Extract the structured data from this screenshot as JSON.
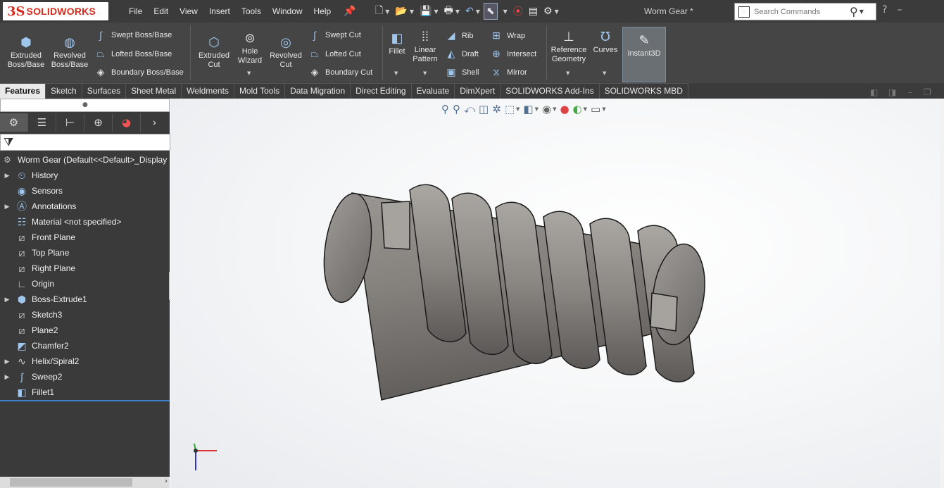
{
  "app": {
    "logo_mark": "3S",
    "logo_text": "SOLIDWORKS",
    "doc_title": "Worm Gear *"
  },
  "menu": [
    "File",
    "Edit",
    "View",
    "Insert",
    "Tools",
    "Window",
    "Help"
  ],
  "search": {
    "placeholder": "Search Commands"
  },
  "ribbon": {
    "extruded_boss": "Extruded\nBoss/Base",
    "revolved_boss": "Revolved\nBoss/Base",
    "swept_boss": "Swept Boss/Base",
    "lofted_boss": "Lofted Boss/Base",
    "boundary_boss": "Boundary Boss/Base",
    "extruded_cut": "Extruded\nCut",
    "hole_wizard": "Hole\nWizard",
    "revolved_cut": "Revolved\nCut",
    "swept_cut": "Swept Cut",
    "lofted_cut": "Lofted Cut",
    "boundary_cut": "Boundary Cut",
    "fillet": "Fillet",
    "linear_pattern": "Linear\nPattern",
    "rib": "Rib",
    "draft": "Draft",
    "shell": "Shell",
    "wrap": "Wrap",
    "intersect": "Intersect",
    "mirror": "Mirror",
    "reference_geometry": "Reference\nGeometry",
    "curves": "Curves",
    "instant3d": "Instant3D"
  },
  "tabs": [
    "Features",
    "Sketch",
    "Surfaces",
    "Sheet Metal",
    "Weldments",
    "Mold Tools",
    "Data Migration",
    "Direct Editing",
    "Evaluate",
    "DimXpert",
    "SOLIDWORKS Add-Ins",
    "SOLIDWORKS MBD"
  ],
  "active_tab": "Features",
  "tree": {
    "root": "Worm Gear  (Default<<Default>_Display",
    "items": [
      {
        "label": "History",
        "icon": "history-icon",
        "expandable": true
      },
      {
        "label": "Sensors",
        "icon": "sensors-icon",
        "expandable": false
      },
      {
        "label": "Annotations",
        "icon": "annotations-icon",
        "expandable": true
      },
      {
        "label": "Material <not specified>",
        "icon": "material-icon",
        "expandable": false
      },
      {
        "label": "Front Plane",
        "icon": "plane-icon",
        "expandable": false
      },
      {
        "label": "Top Plane",
        "icon": "plane-icon",
        "expandable": false
      },
      {
        "label": "Right Plane",
        "icon": "plane-icon",
        "expandable": false
      },
      {
        "label": "Origin",
        "icon": "origin-icon",
        "expandable": false
      },
      {
        "label": "Boss-Extrude1",
        "icon": "extrude-icon",
        "expandable": true
      },
      {
        "label": "Sketch3",
        "icon": "sketch-icon",
        "expandable": false
      },
      {
        "label": "Plane2",
        "icon": "plane-icon",
        "expandable": false
      },
      {
        "label": "Chamfer2",
        "icon": "chamfer-icon",
        "expandable": false
      },
      {
        "label": "Helix/Spiral2",
        "icon": "helix-icon",
        "expandable": true
      },
      {
        "label": "Sweep2",
        "icon": "sweep-icon",
        "expandable": true
      },
      {
        "label": "Fillet1",
        "icon": "fillet-icon",
        "expandable": false
      }
    ]
  },
  "colors": {
    "titlebar_bg": "#3b3b3b",
    "ribbon_bg": "#454545",
    "panel_bg": "#3a3a3a",
    "brand_red": "#d52b1e",
    "model_gray": "#8a8784",
    "selection_blue": "#3d7ecc"
  }
}
